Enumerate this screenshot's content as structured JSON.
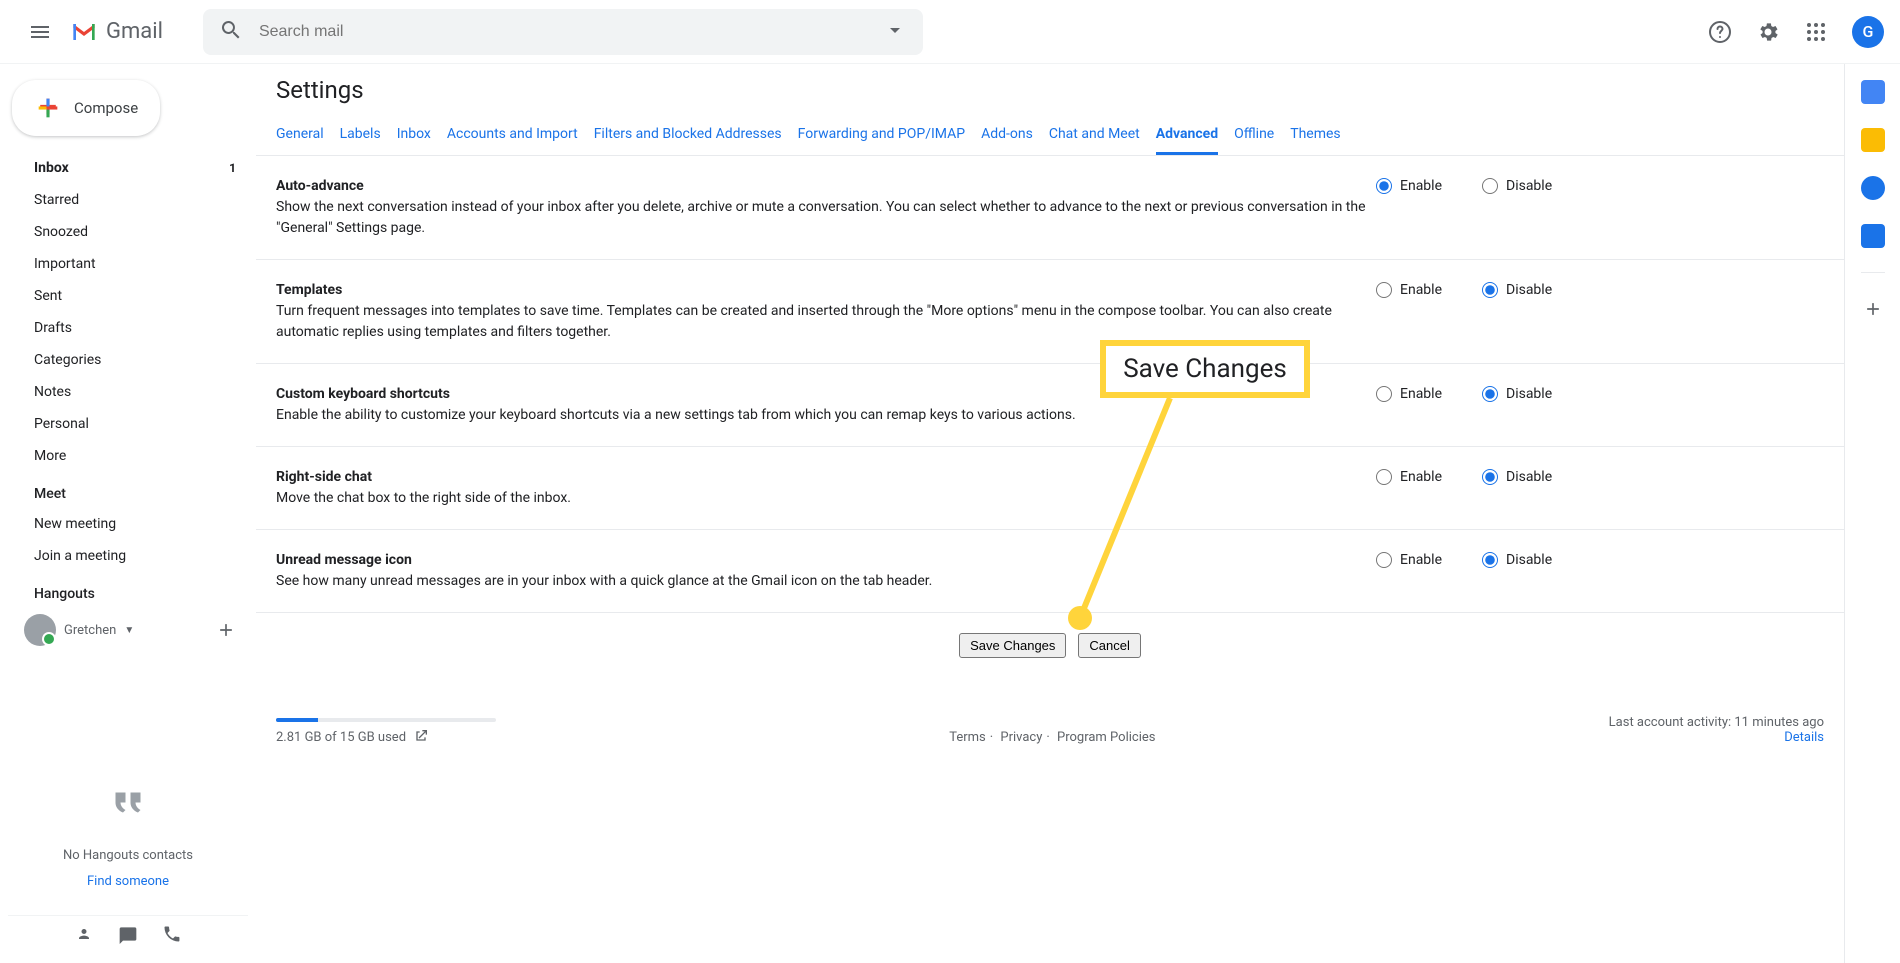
{
  "header": {
    "logo_text": "Gmail",
    "search_placeholder": "Search mail",
    "avatar_initial": "G"
  },
  "compose_label": "Compose",
  "sidebar": {
    "items": [
      {
        "label": "Inbox",
        "count": "1",
        "bold": true
      },
      {
        "label": "Starred"
      },
      {
        "label": "Snoozed"
      },
      {
        "label": "Important"
      },
      {
        "label": "Sent"
      },
      {
        "label": "Drafts"
      },
      {
        "label": "Categories"
      },
      {
        "label": "Notes"
      },
      {
        "label": "Personal"
      },
      {
        "label": "More"
      }
    ],
    "meet_header": "Meet",
    "meet_items": [
      {
        "label": "New meeting"
      },
      {
        "label": "Join a meeting"
      }
    ],
    "hangouts_header": "Hangouts",
    "hangouts_user": "Gretchen",
    "no_contacts_msg": "No Hangouts contacts",
    "find_someone": "Find someone"
  },
  "main": {
    "title": "Settings",
    "tabs": [
      "General",
      "Labels",
      "Inbox",
      "Accounts and Import",
      "Filters and Blocked Addresses",
      "Forwarding and POP/IMAP",
      "Add-ons",
      "Chat and Meet",
      "Advanced",
      "Offline",
      "Themes"
    ],
    "active_tab_index": 8,
    "settings": [
      {
        "title": "Auto-advance",
        "desc": "Show the next conversation instead of your inbox after you delete, archive or mute a conversation. You can select whether to advance to the next or previous conversation in the \"General\" Settings page.",
        "selected": "enable"
      },
      {
        "title": "Templates",
        "desc": "Turn frequent messages into templates to save time. Templates can be created and inserted through the \"More options\" menu in the compose toolbar. You can also create automatic replies using templates and filters together.",
        "selected": "disable"
      },
      {
        "title": "Custom keyboard shortcuts",
        "desc": "Enable the ability to customize your keyboard shortcuts via a new settings tab from which you can remap keys to various actions.",
        "selected": "disable"
      },
      {
        "title": "Right-side chat",
        "desc": "Move the chat box to the right side of the inbox.",
        "selected": "disable"
      },
      {
        "title": "Unread message icon",
        "desc": "See how many unread messages are in your inbox with a quick glance at the Gmail icon on the tab header.",
        "selected": "disable"
      }
    ],
    "radio_labels": {
      "enable": "Enable",
      "disable": "Disable"
    },
    "save_changes_label": "Save Changes",
    "cancel_label": "Cancel"
  },
  "footer": {
    "terms": "Terms",
    "privacy": "Privacy",
    "program_policies": "Program Policies",
    "activity": "Last account activity: 11 minutes ago",
    "details": "Details",
    "storage_used": "2.81 GB of 15 GB used"
  },
  "callout": {
    "label": "Save Changes"
  }
}
